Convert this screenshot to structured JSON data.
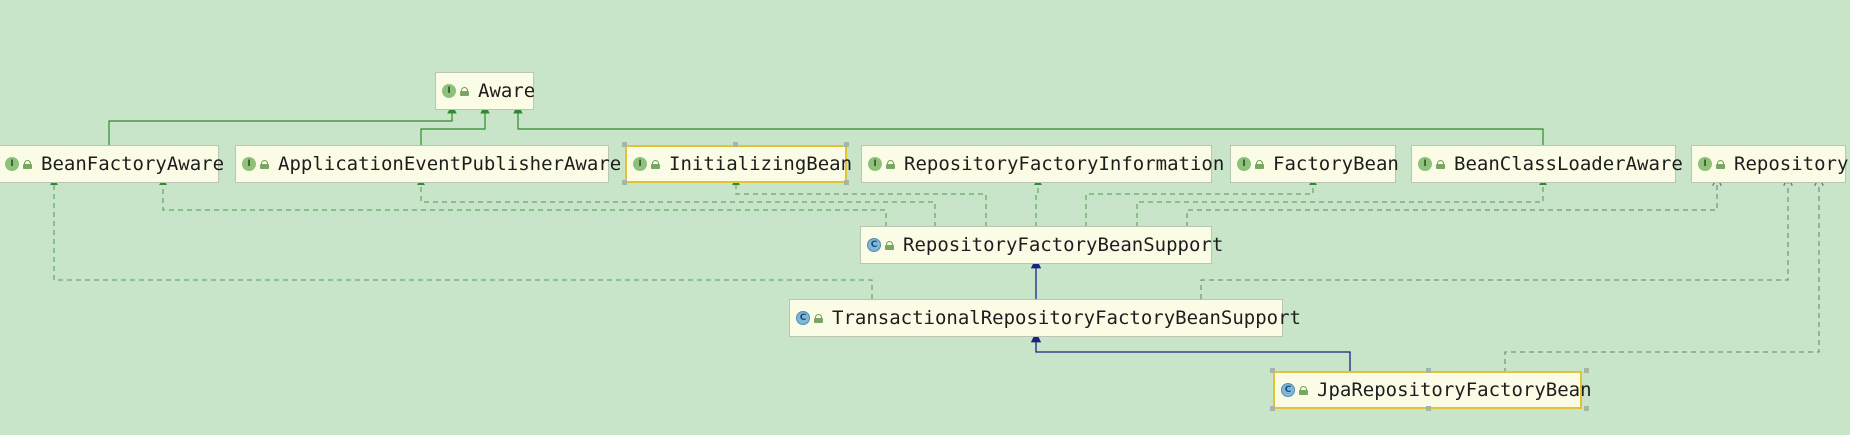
{
  "diagram": {
    "nodes": [
      {
        "id": "aware",
        "label": "Aware",
        "kind": "interface",
        "icon": "interface-icon"
      },
      {
        "id": "beanFactoryAware",
        "label": "BeanFactoryAware",
        "kind": "interface",
        "icon": "interface-icon"
      },
      {
        "id": "applicationEventPublisherAware",
        "label": "ApplicationEventPublisherAware",
        "kind": "interface",
        "icon": "interface-icon"
      },
      {
        "id": "initializingBean",
        "label": "InitializingBean",
        "kind": "interface",
        "icon": "interface-icon",
        "selected": true
      },
      {
        "id": "repositoryFactoryInformation",
        "label": "RepositoryFactoryInformation",
        "kind": "interface",
        "icon": "interface-icon"
      },
      {
        "id": "factoryBean",
        "label": "FactoryBean",
        "kind": "interface",
        "icon": "interface-icon"
      },
      {
        "id": "beanClassLoaderAware",
        "label": "BeanClassLoaderAware",
        "kind": "interface",
        "icon": "interface-icon"
      },
      {
        "id": "repository",
        "label": "Repository",
        "kind": "interface",
        "icon": "interface-icon"
      },
      {
        "id": "repositoryFactoryBeanSupport",
        "label": "RepositoryFactoryBeanSupport",
        "kind": "class",
        "icon": "class-icon"
      },
      {
        "id": "transactionalRepositoryFactoryBeanSupport",
        "label": "TransactionalRepositoryFactoryBeanSupport",
        "kind": "class",
        "icon": "class-icon"
      },
      {
        "id": "jpaRepositoryFactoryBean",
        "label": "JpaRepositoryFactoryBean",
        "kind": "class",
        "icon": "class-icon",
        "selected": true
      }
    ],
    "edges": [
      {
        "from": "beanFactoryAware",
        "to": "aware",
        "type": "extends"
      },
      {
        "from": "applicationEventPublisherAware",
        "to": "aware",
        "type": "extends"
      },
      {
        "from": "beanClassLoaderAware",
        "to": "aware",
        "type": "extends"
      },
      {
        "from": "repositoryFactoryBeanSupport",
        "to": "beanFactoryAware",
        "type": "implements"
      },
      {
        "from": "repositoryFactoryBeanSupport",
        "to": "applicationEventPublisherAware",
        "type": "implements"
      },
      {
        "from": "repositoryFactoryBeanSupport",
        "to": "initializingBean",
        "type": "implements"
      },
      {
        "from": "repositoryFactoryBeanSupport",
        "to": "repositoryFactoryInformation",
        "type": "implements"
      },
      {
        "from": "repositoryFactoryBeanSupport",
        "to": "factoryBean",
        "type": "implements"
      },
      {
        "from": "repositoryFactoryBeanSupport",
        "to": "beanClassLoaderAware",
        "type": "implements"
      },
      {
        "from": "repositoryFactoryBeanSupport",
        "to": "repository",
        "type": "uses"
      },
      {
        "from": "transactionalRepositoryFactoryBeanSupport",
        "to": "repositoryFactoryBeanSupport",
        "type": "extends-class"
      },
      {
        "from": "transactionalRepositoryFactoryBeanSupport",
        "to": "beanFactoryAware",
        "type": "implements"
      },
      {
        "from": "transactionalRepositoryFactoryBeanSupport",
        "to": "repository",
        "type": "uses"
      },
      {
        "from": "jpaRepositoryFactoryBean",
        "to": "transactionalRepositoryFactoryBeanSupport",
        "type": "extends-class"
      },
      {
        "from": "jpaRepositoryFactoryBean",
        "to": "repository",
        "type": "uses"
      }
    ],
    "colors": {
      "background": "#c9e5c9",
      "node_fill": "#fbfce6",
      "extends_green": "#2e8b2e",
      "extends_class_blue": "#1a237e",
      "implements_green": "#4b9a4b",
      "uses_gray": "#6a7a6a",
      "selected_border": "#e2c335"
    }
  }
}
